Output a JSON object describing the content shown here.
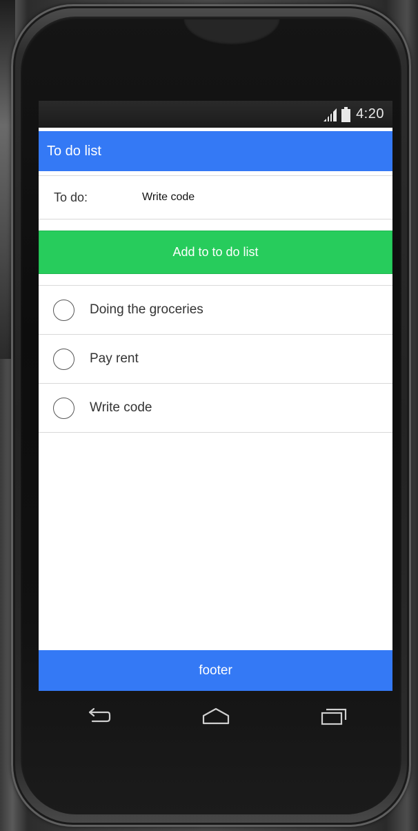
{
  "status_bar": {
    "time": "4:20",
    "icons": [
      "signal-icon",
      "battery-icon"
    ]
  },
  "header": {
    "title": "To do list"
  },
  "form": {
    "label": "To do:",
    "input_value": "Write code",
    "add_button_label": "Add to to do list"
  },
  "todo_items": [
    {
      "text": "Doing the groceries",
      "checked": false
    },
    {
      "text": "Pay rent",
      "checked": false
    },
    {
      "text": "Write code",
      "checked": false
    }
  ],
  "footer": {
    "text": "footer"
  },
  "nav": {
    "icons": [
      "back-icon",
      "home-icon",
      "recent-apps-icon"
    ]
  },
  "colors": {
    "header_blue": "#3479f5",
    "add_button_green": "#27cc5c",
    "footer_blue": "#3479f5"
  }
}
